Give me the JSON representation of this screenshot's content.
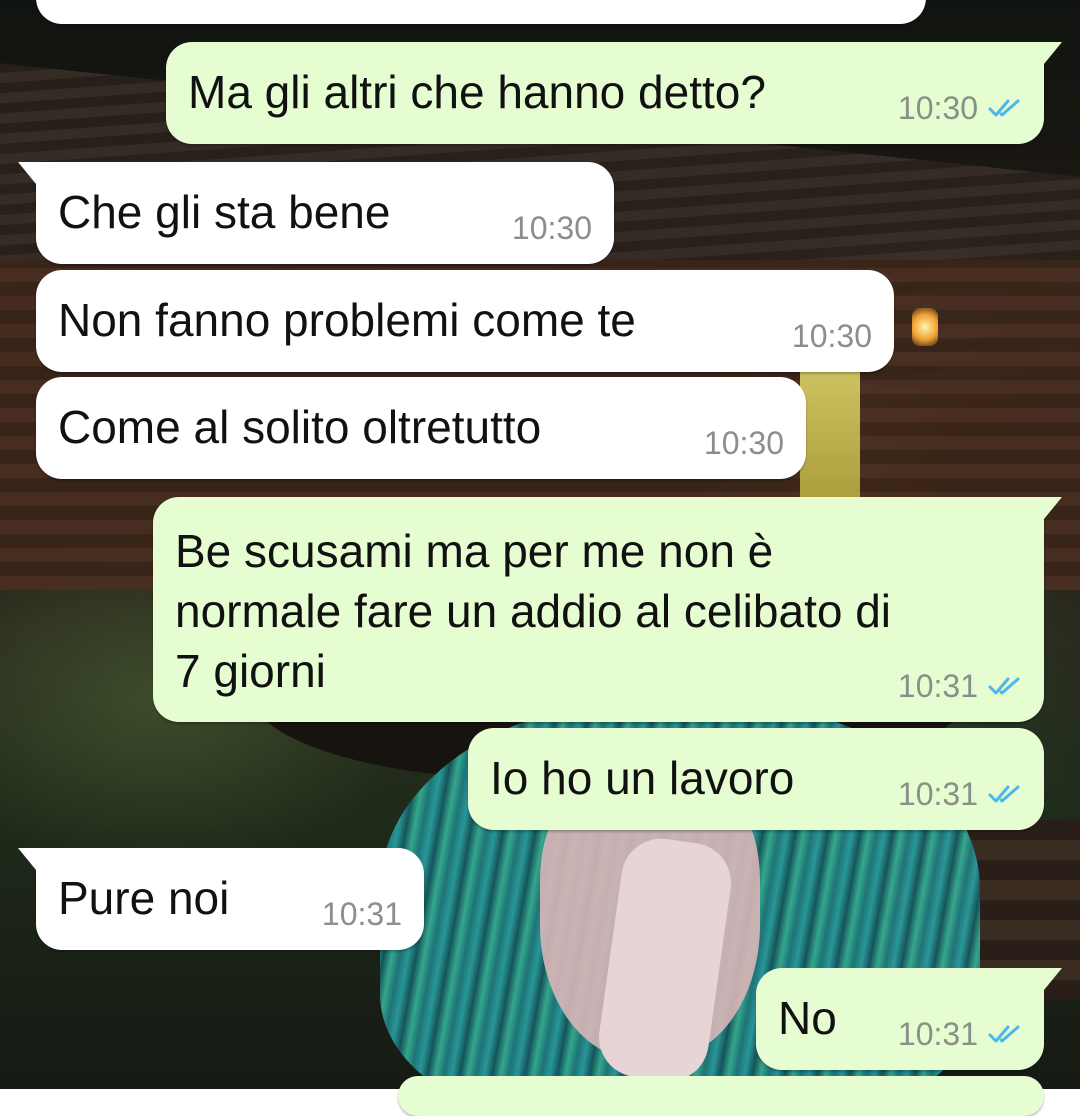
{
  "colors": {
    "incoming_bubble": "#ffffff",
    "outgoing_bubble": "#e6fdd2",
    "text": "#111111",
    "timestamp": "#8a8f8a",
    "read_ticks": "#4fb6ec"
  },
  "messages": [
    {
      "id": "m1",
      "direction": "out",
      "text": "Ma gli altri che hanno detto?",
      "time": "10:30",
      "status_icon": "double-check-icon"
    },
    {
      "id": "m2",
      "direction": "in",
      "text": "Che gli sta bene",
      "time": "10:30"
    },
    {
      "id": "m3",
      "direction": "in",
      "text": "Non fanno problemi come te",
      "time": "10:30"
    },
    {
      "id": "m4",
      "direction": "in",
      "text": "Come al solito oltretutto",
      "time": "10:30"
    },
    {
      "id": "m5",
      "direction": "out",
      "text": "Be scusami ma per me non è\nnormale fare un addio al celibato di\n7 giorni",
      "time": "10:31",
      "status_icon": "double-check-icon"
    },
    {
      "id": "m6",
      "direction": "out",
      "text": "Io ho un lavoro",
      "time": "10:31",
      "status_icon": "double-check-icon"
    },
    {
      "id": "m7",
      "direction": "in",
      "text": "Pure noi",
      "time": "10:31"
    },
    {
      "id": "m8",
      "direction": "out",
      "text": "No",
      "time": "10:31",
      "status_icon": "double-check-icon"
    }
  ]
}
